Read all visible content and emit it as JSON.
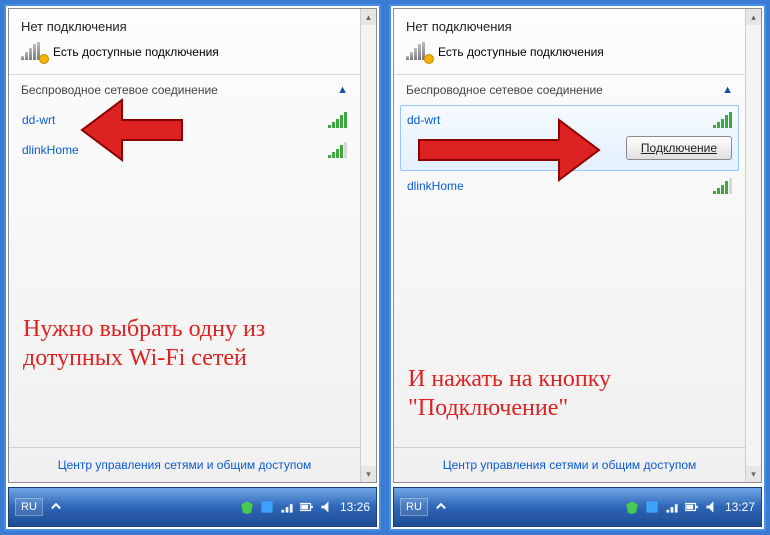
{
  "left": {
    "header_title": "Нет подключения",
    "avail_text": "Есть доступные подключения",
    "section_title": "Беспроводное сетевое соединение",
    "chevron": "▲",
    "networks": [
      {
        "name": "dd-wrt",
        "strength": "s4"
      },
      {
        "name": "dlinkHome",
        "strength": "s3"
      }
    ],
    "footer": "Центр управления сетями и общим доступом",
    "annotation": "Нужно выбрать одну из дотупных Wi-Fi сетей",
    "taskbar": {
      "lang": "RU",
      "time": "13:26"
    }
  },
  "right": {
    "header_title": "Нет подключения",
    "avail_text": "Есть доступные подключения",
    "section_title": "Беспроводное сетевое соединение",
    "chevron": "▲",
    "selected_network": "dd-wrt",
    "connect_label": "Подключение",
    "other_network": "dlinkHome",
    "footer": "Центр управления сетями и общим доступом",
    "annotation": "И нажать на кнопку \"Подключение\"",
    "taskbar": {
      "lang": "RU",
      "time": "13:27"
    }
  }
}
